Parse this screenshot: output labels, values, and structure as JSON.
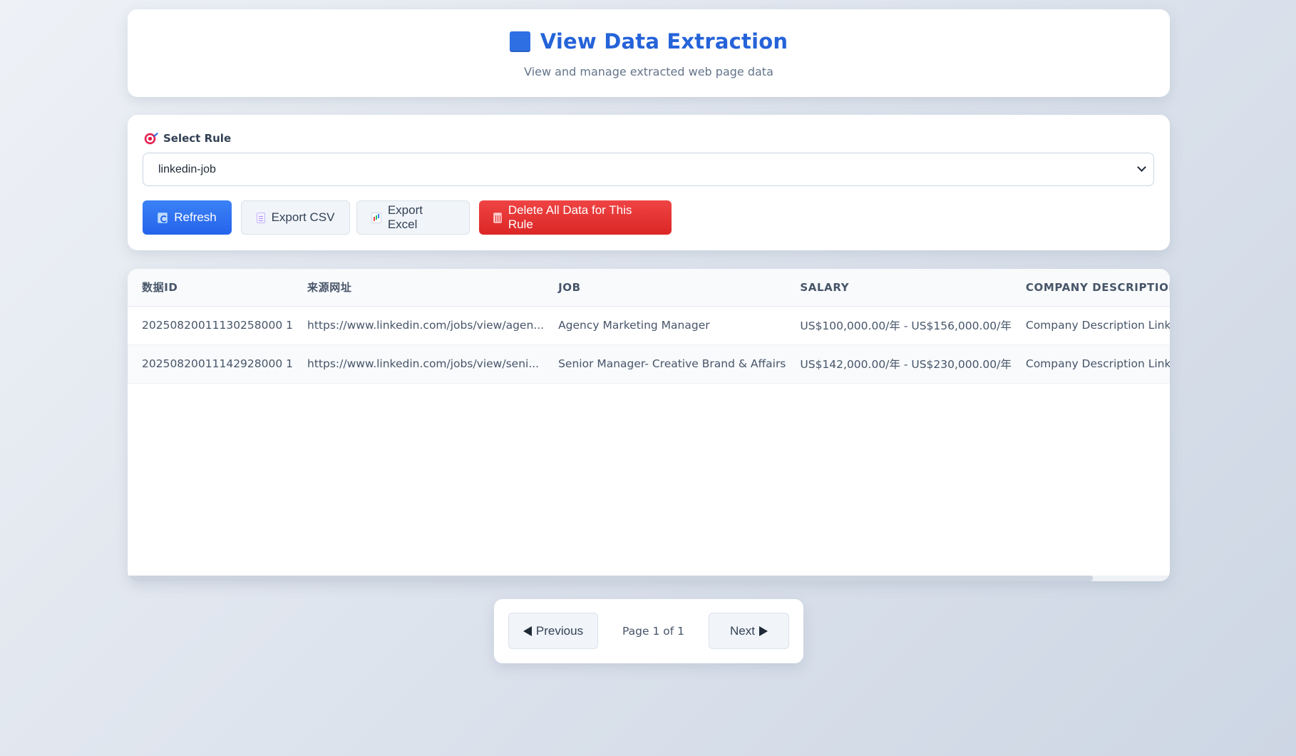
{
  "header": {
    "title": "View Data Extraction",
    "subtitle": "View and manage extracted web page data"
  },
  "rule": {
    "label": "Select Rule",
    "selected": "linkedin-job"
  },
  "actions": {
    "refresh": "Refresh",
    "export_csv": "Export CSV",
    "export_excel": "Export Excel",
    "delete_all": "Delete All Data for This Rule"
  },
  "table": {
    "columns": [
      "数据ID",
      "来源网址",
      "JOB",
      "SALARY",
      "COMPANY DESCRIPTION"
    ],
    "rows": [
      [
        "20250820011130258000 1",
        "https://www.linkedin.com/jobs/view/agen...",
        "Agency Marketing Manager",
        "US$100,000.00/年 - US$156,000.00/年",
        "Company Description LinkedIn"
      ],
      [
        "20250820011142928000 1",
        "https://www.linkedin.com/jobs/view/seni...",
        "Senior Manager- Creative Brand & Affairs",
        "US$142,000.00/年 - US$230,000.00/年",
        "Company Description LinkedIn"
      ]
    ]
  },
  "pagination": {
    "previous": "Previous",
    "page_info": "Page 1 of 1",
    "next": "Next"
  },
  "colors": {
    "accent": "#2563eb",
    "danger": "#dc2626"
  }
}
